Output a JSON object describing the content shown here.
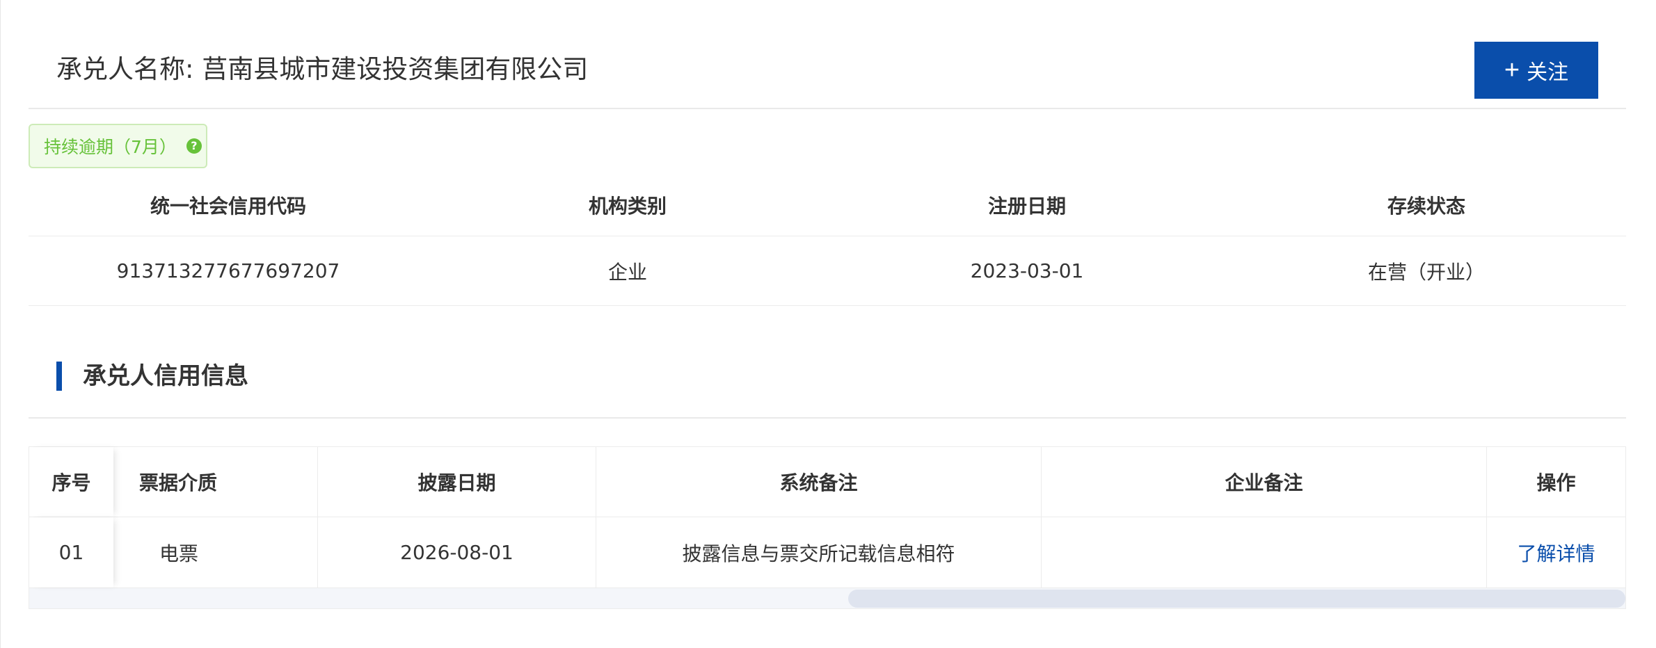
{
  "header": {
    "acceptor_title": "承兑人名称: 莒南县城市建设投资集团有限公司",
    "follow_label": "关注",
    "follow_icon": "plus-icon"
  },
  "tag": {
    "label": "持续逾期（7月）",
    "help_glyph": "?",
    "color": "#67c23a"
  },
  "info_table": {
    "headers": [
      "统一社会信用代码",
      "机构类别",
      "注册日期",
      "存续状态"
    ],
    "values": [
      "913713277677697207",
      "企业",
      "2023-03-01",
      "在营（开业）"
    ]
  },
  "section": {
    "title": "承兑人信用信息",
    "accent_color": "#0a4eab"
  },
  "credit_table": {
    "headers": [
      "序号",
      "票据介质",
      "披露日期",
      "系统备注",
      "企业备注",
      "操作"
    ],
    "rows": [
      {
        "index": "01",
        "medium": "电票",
        "date": "2026-08-01",
        "system_note": "披露信息与票交所记载信息相符",
        "company_note": "",
        "action": "了解详情"
      }
    ]
  }
}
